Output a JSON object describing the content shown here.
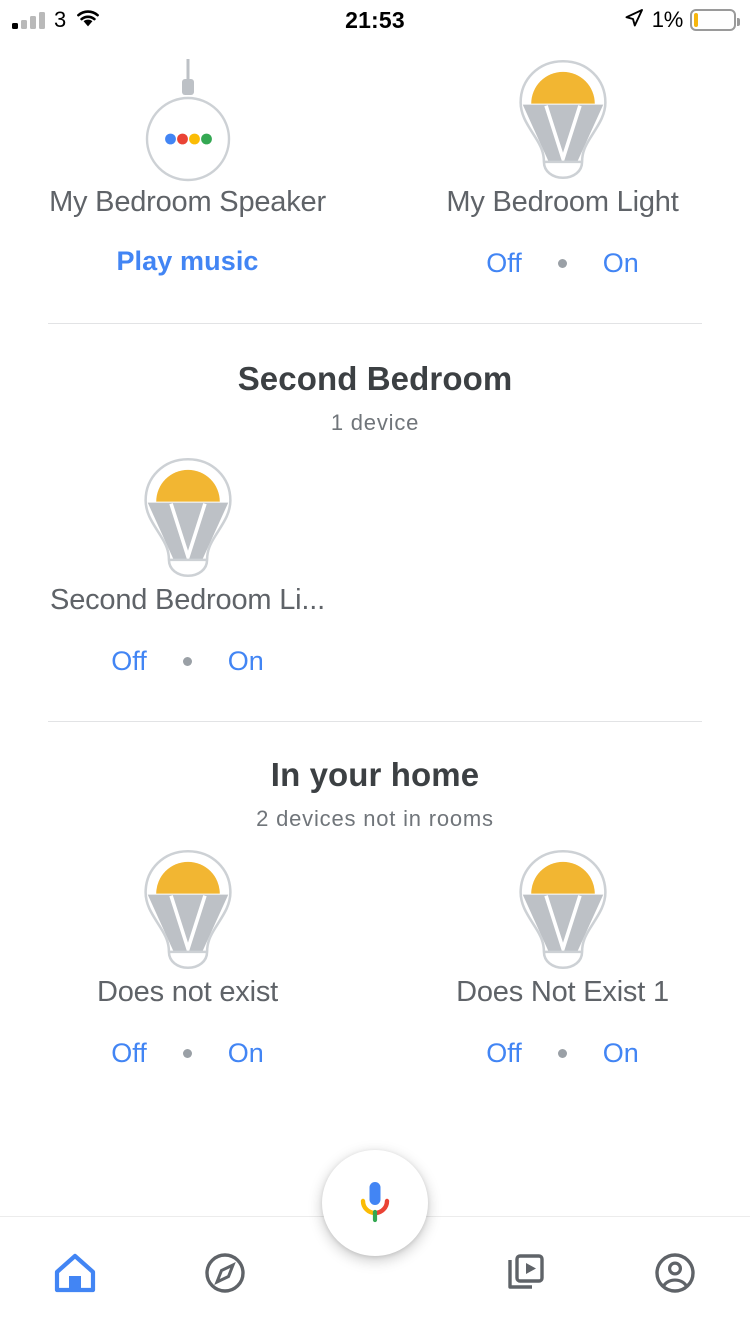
{
  "status_bar": {
    "carrier": "3",
    "time": "21:53",
    "battery_percent": "1%",
    "signal_icon": "signal-bars-icon",
    "wifi_icon": "wifi-icon",
    "location_icon": "location-arrow-icon",
    "battery_icon": "battery-icon"
  },
  "ghost_scrolled_text": "2 devices",
  "colors": {
    "accent_blue": "#4285f4",
    "bulb_yellow": "#f2b632",
    "bulb_gray": "#bdc1c6",
    "text_primary": "#3c4043",
    "text_secondary": "#5f6368",
    "text_muted": "#70757a",
    "divider": "#e2e3e5",
    "google_blue": "#4285f4",
    "google_red": "#ea4335",
    "google_yellow": "#fbbc05",
    "google_green": "#34a853"
  },
  "sections": [
    {
      "id": "first-bedroom",
      "title": null,
      "subtitle": null,
      "devices": [
        {
          "name": "My Bedroom Speaker",
          "icon": "speaker-icon",
          "control_type": "action",
          "action_label": "Play music"
        },
        {
          "name": "My Bedroom Light",
          "icon": "lightbulb-icon",
          "control_type": "toggle",
          "off_label": "Off",
          "on_label": "On"
        }
      ]
    },
    {
      "id": "second-bedroom",
      "title": "Second Bedroom",
      "subtitle": "1 device",
      "devices": [
        {
          "name": "Second Bedroom Li...",
          "icon": "lightbulb-icon",
          "control_type": "toggle",
          "off_label": "Off",
          "on_label": "On"
        }
      ]
    },
    {
      "id": "in-your-home",
      "title": "In your home",
      "subtitle": "2 devices not in rooms",
      "devices": [
        {
          "name": "Does not exist",
          "icon": "lightbulb-icon",
          "control_type": "toggle",
          "off_label": "Off",
          "on_label": "On"
        },
        {
          "name": "Does Not Exist 1",
          "icon": "lightbulb-icon",
          "control_type": "toggle",
          "off_label": "Off",
          "on_label": "On"
        }
      ]
    }
  ],
  "assistant_button": {
    "icon": "google-assistant-mic-icon",
    "label": "Google Assistant"
  },
  "bottom_nav": {
    "active_index": 0,
    "items": [
      {
        "icon": "home-icon",
        "name": "home",
        "active": true
      },
      {
        "icon": "compass-explore-icon",
        "name": "explore",
        "active": false
      },
      {
        "icon": "media-play-icon",
        "name": "media",
        "active": false
      },
      {
        "icon": "account-circle-icon",
        "name": "account",
        "active": false
      }
    ]
  }
}
